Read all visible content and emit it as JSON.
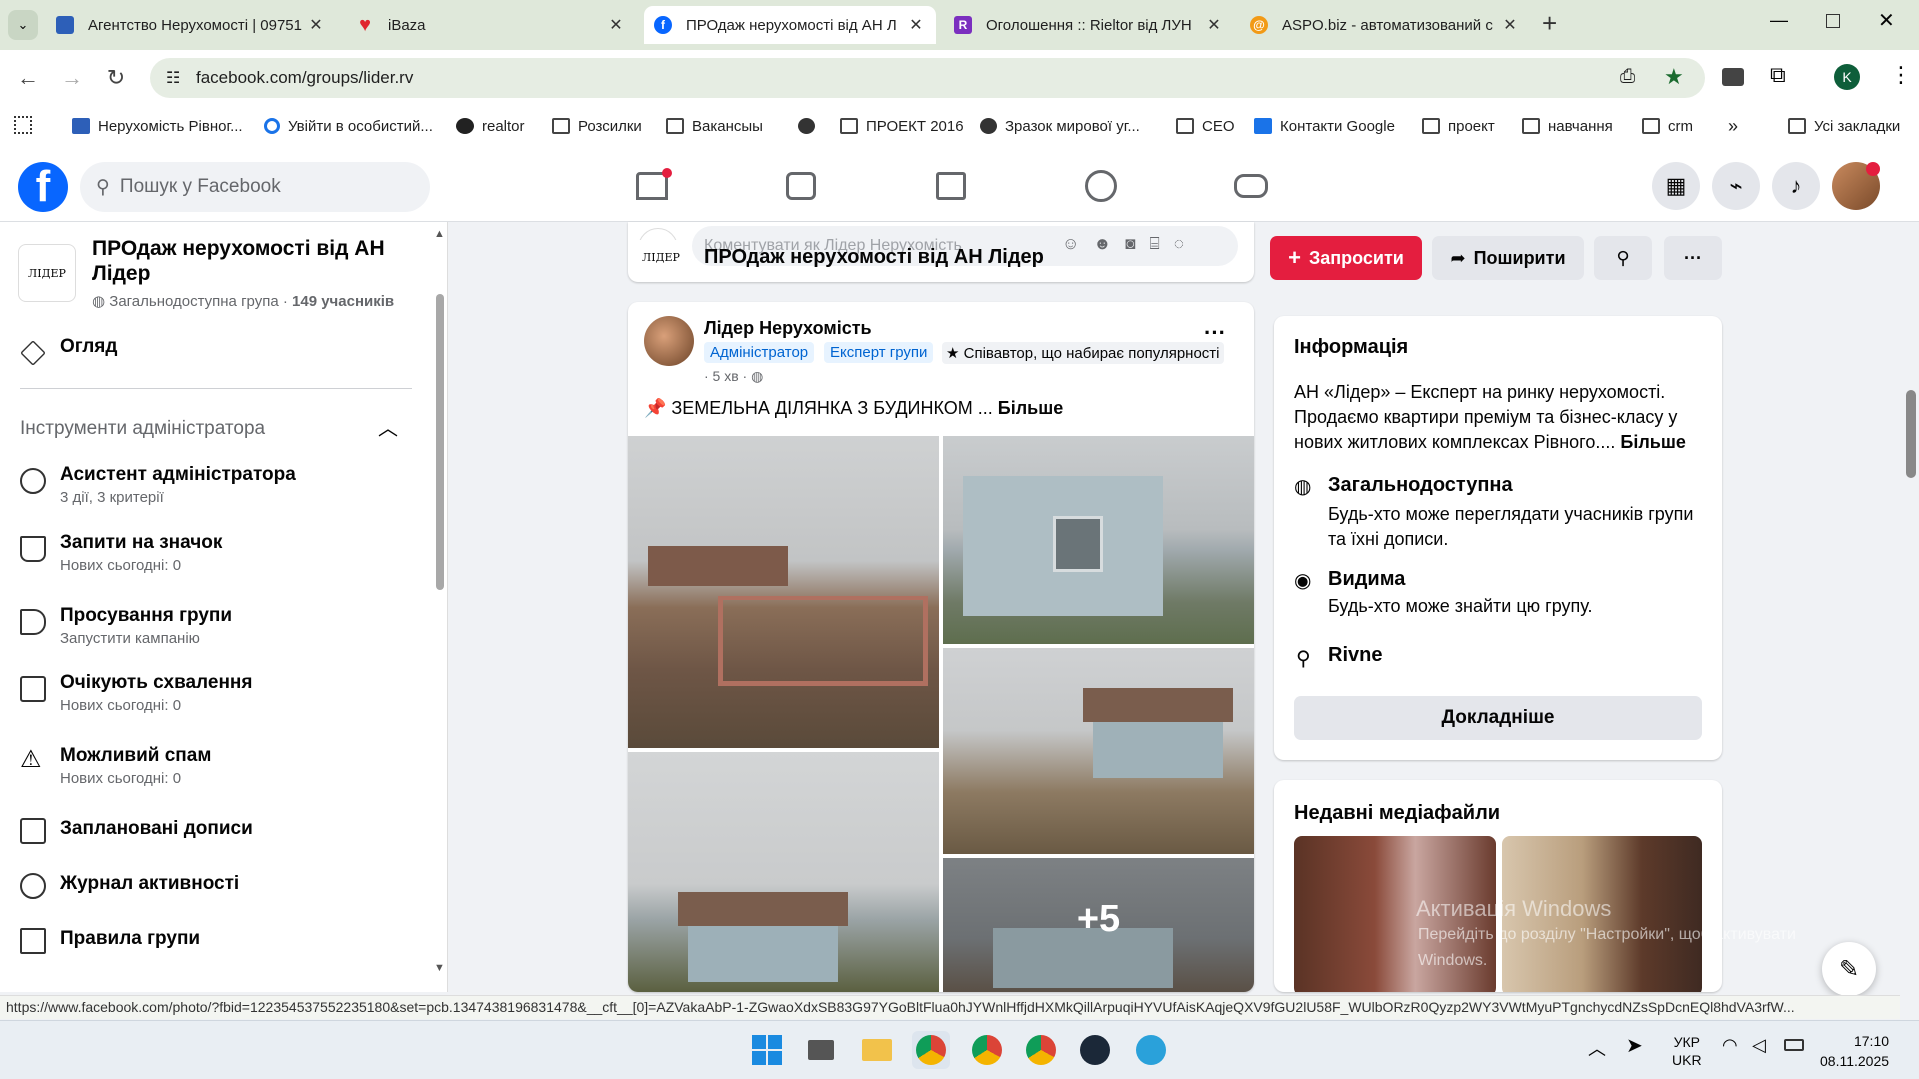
{
  "browser": {
    "tabs": [
      {
        "title": "Агентство Нерухомості | 09751",
        "favicon_color": "#2d5fb8"
      },
      {
        "title": "iBaza",
        "favicon_color": "#e0262e"
      },
      {
        "title": "ПРОдаж нерухомості від АН Л",
        "favicon_color": "#0866ff"
      },
      {
        "title": "Оголошення :: Rieltor від ЛУН",
        "favicon_color": "#7b2fbf"
      },
      {
        "title": "ASPO.biz - автоматизований с",
        "favicon_color": "#f29a16"
      }
    ],
    "url": "facebook.com/groups/lider.rv",
    "profile_initial": "K",
    "bookmarks": [
      "Нерухомість Рівног...",
      "Увійти в особистий...",
      "realtor",
      "Розсилки",
      "Вакансыы",
      "",
      "ПРОЕКТ 2016",
      "Зразок мирової уг...",
      "CEO",
      "Контакти Google",
      "проект",
      "навчання",
      "crm"
    ],
    "all_bookmarks": "Усі закладки",
    "status_url": "https://www.facebook.com/photo/?fbid=122354537552235180&set=pcb.1347438196831478&__cft__[0]=AZVakaAbP-1-ZGwaoXdxSB83G97YGoBltFlua0hJYWnlHffjdHXMkQillArpuqiHYVUfAisKAqjeQXV9fGU2lU58F_WUlbORzR0Qyzp2WY3VWtMyuPTgnchycdNZsSpDcnEQl8hdVA3rfW..."
  },
  "facebook": {
    "search_placeholder": "Пошук у Facebook"
  },
  "group": {
    "name": "ПРОдаж нерухомості від АН Лідер",
    "logo_text": "ЛІДЕР",
    "meta_type": "Загальнодоступна група · ",
    "meta_members": "149 учасників",
    "overview": "Огляд",
    "admin_tools_title": "Інструменти адміністратора",
    "admin_items": [
      {
        "title": "Асистент адміністратора",
        "sub": "3 дії, 3 критерії",
        "icon": "assistant-icon"
      },
      {
        "title": "Запити на значок",
        "sub": "Нових сьогодні: 0",
        "icon": "badge-icon"
      },
      {
        "title": "Просування групи",
        "sub": "Запустити кампанію",
        "icon": "megaphone-icon"
      },
      {
        "title": "Очікують схвалення",
        "sub": "Нових сьогодні: 0",
        "icon": "pending-icon"
      },
      {
        "title": "Можливий спам",
        "sub": "Нових сьогодні: 0",
        "icon": "warning-icon"
      },
      {
        "title": "Заплановані дописи",
        "sub": "",
        "icon": "calendar-icon"
      },
      {
        "title": "Журнал активності",
        "sub": "",
        "icon": "clock-icon"
      },
      {
        "title": "Правила групи",
        "sub": "",
        "icon": "book-icon"
      }
    ],
    "invite_label": "Запросити",
    "share_label": "Поширити"
  },
  "comment_placeholder": "Коментувати як Лідер Нерухомість",
  "post": {
    "author": "Лідер Нерухомість",
    "badges": [
      "Адміністратор",
      "Експерт групи"
    ],
    "star_badge": "Співавтор, що набирає популярності",
    "time": "· 5 хв ·",
    "text": "📌 ЗЕМЕЛЬНА ДІЛЯНКА З БУДИНКОМ ...",
    "more": "Більше",
    "extra_photos": "+5"
  },
  "info": {
    "title": "Інформація",
    "description": "АН «Лідер» – Експерт на ринку нерухомості. Продаємо квартири преміум та бізнес-класу у нових житлових комплексах Рівного.... ",
    "more": "Більше",
    "public_title": "Загальнодоступна",
    "public_desc": "Будь-хто може переглядати учасників групи та їхні дописи.",
    "visible_title": "Видима",
    "visible_desc": "Будь-хто може знайти цю групу.",
    "location": "Rivne",
    "details_button": "Докладніше"
  },
  "recent_media_title": "Недавні медіафайли",
  "watermark": {
    "line1": "Активація Windows",
    "line2": "Перейдіть до розділу \"Настройки\", щоб активувати",
    "line3": "Windows."
  },
  "taskbar": {
    "lang1": "УКР",
    "lang2": "UKR",
    "time": "17:10",
    "date": "08.11.2025"
  }
}
